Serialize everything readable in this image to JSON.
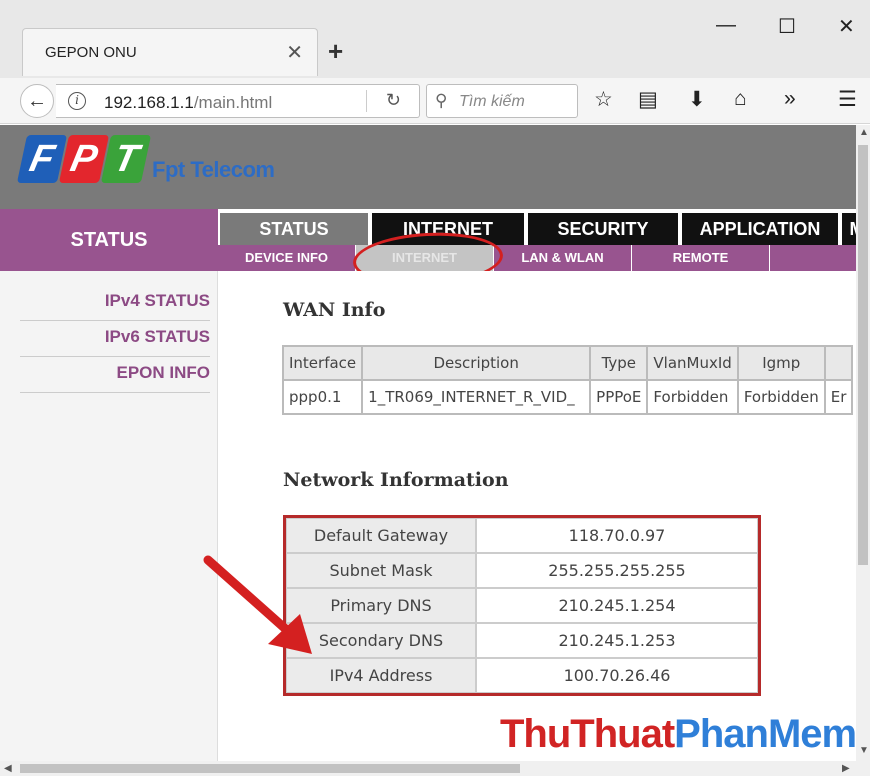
{
  "browser": {
    "tab_title": "GEPON ONU",
    "tab_close": "✕",
    "new_tab": "+",
    "minimize": "—",
    "maximize": "☐",
    "close": "✕",
    "url_host": "192.168.1.1",
    "url_path": "/main.html",
    "search_placeholder": "Tìm kiếm",
    "toolbar_icons": [
      "star-icon",
      "reader-icon",
      "download-icon",
      "home-icon",
      "overflow-icon",
      "menu-icon"
    ]
  },
  "header": {
    "logo_letters": [
      "F",
      "P",
      "T"
    ],
    "logo_colors": [
      "#1f5fb8",
      "#e3262d",
      "#3aa33a"
    ],
    "brand": "Fpt Telecom"
  },
  "sidebar": {
    "title": "STATUS",
    "items": [
      "IPv4 STATUS",
      "IPv6 STATUS",
      "EPON INFO"
    ]
  },
  "topmenu": [
    "STATUS",
    "INTERNET",
    "SECURITY",
    "APPLICATION",
    "M"
  ],
  "submenu": [
    "DEVICE INFO",
    "INTERNET",
    "LAN & WLAN",
    "REMOTE"
  ],
  "wan": {
    "title": "WAN Info",
    "headers": [
      "Interface",
      "Description",
      "Type",
      "VlanMuxId",
      "Igmp",
      ""
    ],
    "row": [
      "ppp0.1",
      "1_TR069_INTERNET_R_VID_",
      "PPPoE",
      "Forbidden",
      "Forbidden",
      "Er"
    ]
  },
  "network": {
    "title": "Network Information",
    "rows": [
      {
        "label": "Default Gateway",
        "value": "118.70.0.97"
      },
      {
        "label": "Subnet Mask",
        "value": "255.255.255.255"
      },
      {
        "label": "Primary DNS",
        "value": "210.245.1.254"
      },
      {
        "label": "Secondary DNS",
        "value": "210.245.1.253"
      },
      {
        "label": "IPv4 Address",
        "value": "100.70.26.46"
      }
    ]
  },
  "watermark": {
    "part1": "ThuThuat",
    "part2": "PhanMem.vn"
  },
  "colors": {
    "accent": "#98548f",
    "annotation": "#d42020"
  }
}
